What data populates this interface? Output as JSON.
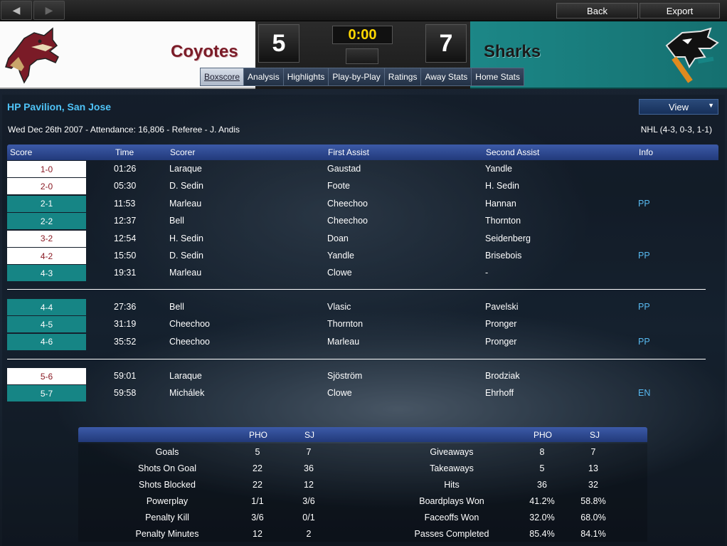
{
  "topbar": {
    "nav_back_icon": "arrow-left-icon",
    "nav_forward_icon": "arrow-right-icon",
    "back_label": "Back",
    "export_label": "Export"
  },
  "header": {
    "home_team": "Coyotes",
    "home_score": "5",
    "away_team": "Sharks",
    "away_score": "7",
    "clock": "0:00",
    "colors": {
      "home_primary": "#7a1b27",
      "away_primary": "#168585",
      "clock": "#ffd800"
    }
  },
  "tabs": [
    {
      "label": "Boxscore",
      "active": true
    },
    {
      "label": "Analysis"
    },
    {
      "label": "Highlights"
    },
    {
      "label": "Play-by-Play"
    },
    {
      "label": "Ratings"
    },
    {
      "label": "Away Stats"
    },
    {
      "label": "Home Stats"
    }
  ],
  "venue": "HP Pavilion, San Jose",
  "view_label": "View",
  "game_info": "Wed Dec 26th 2007 - Attendance: 16,806 - Referee - J. Andis",
  "league_record": "NHL (4-3, 0-3, 1-1)",
  "goals": {
    "columns": [
      "Score",
      "Time",
      "Scorer",
      "First Assist",
      "Second Assist",
      "Info"
    ],
    "periods": [
      [
        {
          "score": "1-0",
          "team": "home",
          "time": "01:26",
          "scorer": "Laraque",
          "a1": "Gaustad",
          "a2": "Yandle",
          "info": ""
        },
        {
          "score": "2-0",
          "team": "home",
          "time": "05:30",
          "scorer": "D. Sedin",
          "a1": "Foote",
          "a2": "H. Sedin",
          "info": ""
        },
        {
          "score": "2-1",
          "team": "away",
          "time": "11:53",
          "scorer": "Marleau",
          "a1": "Cheechoo",
          "a2": "Hannan",
          "info": "PP"
        },
        {
          "score": "2-2",
          "team": "away",
          "time": "12:37",
          "scorer": "Bell",
          "a1": "Cheechoo",
          "a2": "Thornton",
          "info": ""
        },
        {
          "score": "3-2",
          "team": "home",
          "time": "12:54",
          "scorer": "H. Sedin",
          "a1": "Doan",
          "a2": "Seidenberg",
          "info": ""
        },
        {
          "score": "4-2",
          "team": "home",
          "time": "15:50",
          "scorer": "D. Sedin",
          "a1": "Yandle",
          "a2": "Brisebois",
          "info": "PP"
        },
        {
          "score": "4-3",
          "team": "away",
          "time": "19:31",
          "scorer": "Marleau",
          "a1": "Clowe",
          "a2": "-",
          "info": ""
        }
      ],
      [
        {
          "score": "4-4",
          "team": "away",
          "time": "27:36",
          "scorer": "Bell",
          "a1": "Vlasic",
          "a2": "Pavelski",
          "info": "PP"
        },
        {
          "score": "4-5",
          "team": "away",
          "time": "31:19",
          "scorer": "Cheechoo",
          "a1": "Thornton",
          "a2": "Pronger",
          "info": ""
        },
        {
          "score": "4-6",
          "team": "away",
          "time": "35:52",
          "scorer": "Cheechoo",
          "a1": "Marleau",
          "a2": "Pronger",
          "info": "PP"
        }
      ],
      [
        {
          "score": "5-6",
          "team": "home",
          "time": "59:01",
          "scorer": "Laraque",
          "a1": "Sjöström",
          "a2": "Brodziak",
          "info": ""
        },
        {
          "score": "5-7",
          "team": "away",
          "time": "59:58",
          "scorer": "Michálek",
          "a1": "Clowe",
          "a2": "Ehrhoff",
          "info": "EN"
        }
      ]
    ]
  },
  "stats": {
    "home_abbr": "PHO",
    "away_abbr": "SJ",
    "left": [
      {
        "label": "Goals",
        "home": "5",
        "away": "7"
      },
      {
        "label": "Shots On Goal",
        "home": "22",
        "away": "36"
      },
      {
        "label": "Shots Blocked",
        "home": "22",
        "away": "12"
      },
      {
        "label": "Powerplay",
        "home": "1/1",
        "away": "3/6"
      },
      {
        "label": "Penalty Kill",
        "home": "3/6",
        "away": "0/1"
      },
      {
        "label": "Penalty Minutes",
        "home": "12",
        "away": "2"
      }
    ],
    "right": [
      {
        "label": "Giveaways",
        "home": "8",
        "away": "7"
      },
      {
        "label": "Takeaways",
        "home": "5",
        "away": "13"
      },
      {
        "label": "Hits",
        "home": "36",
        "away": "32"
      },
      {
        "label": "Boardplays Won",
        "home": "41.2%",
        "away": "58.8%"
      },
      {
        "label": "Faceoffs Won",
        "home": "32.0%",
        "away": "68.0%"
      },
      {
        "label": "Passes Completed",
        "home": "85.4%",
        "away": "84.1%"
      }
    ]
  }
}
